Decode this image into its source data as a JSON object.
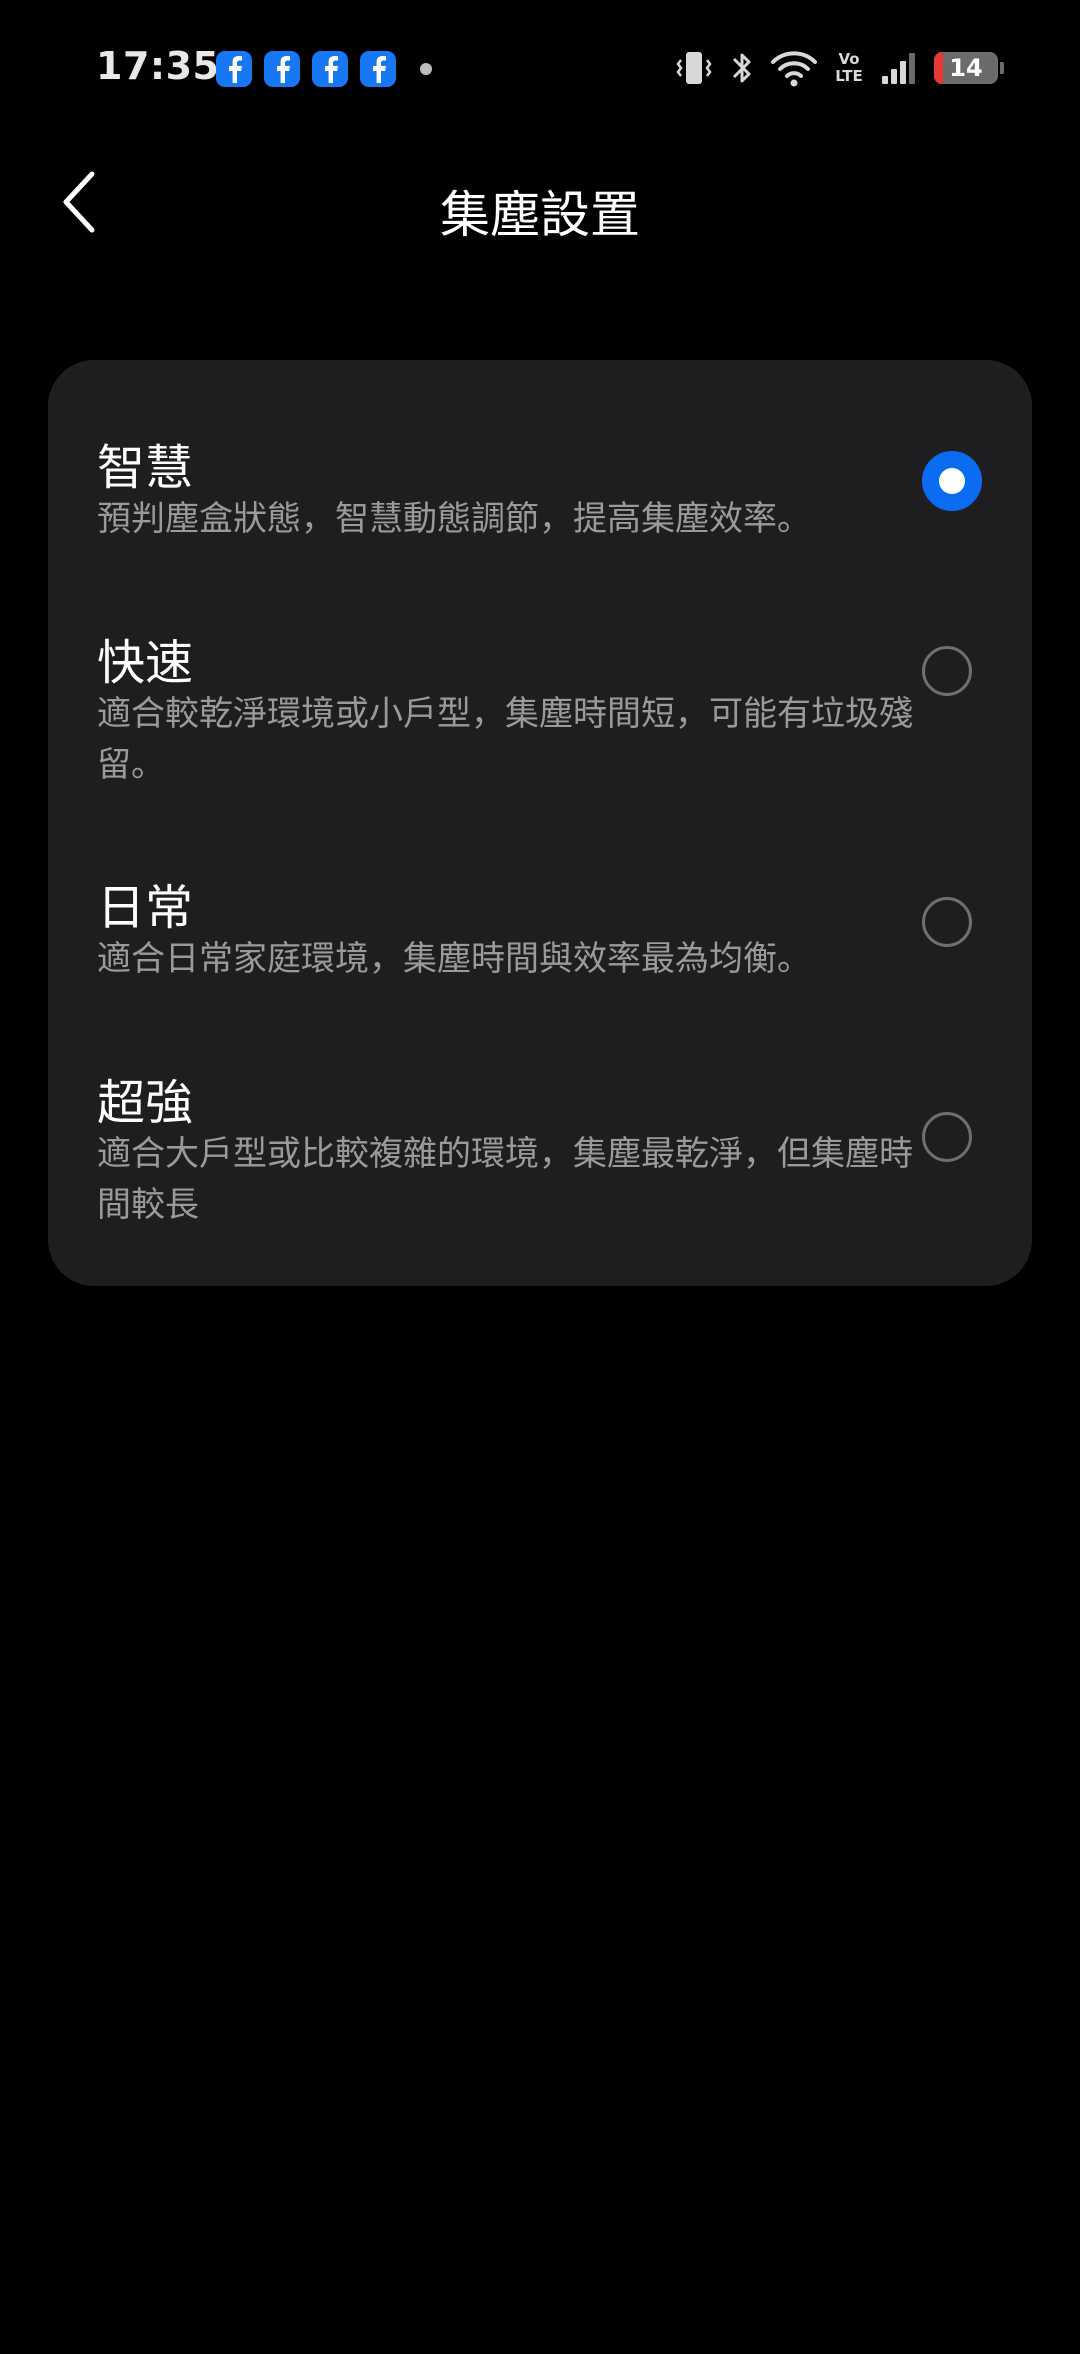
{
  "status_bar": {
    "time": "17:35",
    "notification_icons": [
      "facebook-icon",
      "facebook-icon",
      "facebook-icon",
      "facebook-icon"
    ],
    "network": "Vo LTE",
    "battery_level": "14",
    "battery_color": "#e53935"
  },
  "header": {
    "title": "集塵設置",
    "back_icon": "chevron-left-icon"
  },
  "options": [
    {
      "title": "智慧",
      "description": "預判塵盒狀態，智慧動態調節，提高集塵效率。",
      "selected": true
    },
    {
      "title": "快速",
      "description": "適合較乾淨環境或小戶型，集塵時間短，可能有垃圾殘留。",
      "selected": false
    },
    {
      "title": "日常",
      "description": "適合日常家庭環境，集塵時間與效率最為均衡。",
      "selected": false
    },
    {
      "title": "超強",
      "description": "適合大戶型或比較複雜的環境，集塵最乾淨，但集塵時間較長",
      "selected": false
    }
  ],
  "colors": {
    "background": "#000000",
    "card": "#1e1e20",
    "accent": "#0a6cf0",
    "secondary_text": "#9a9a9a"
  }
}
